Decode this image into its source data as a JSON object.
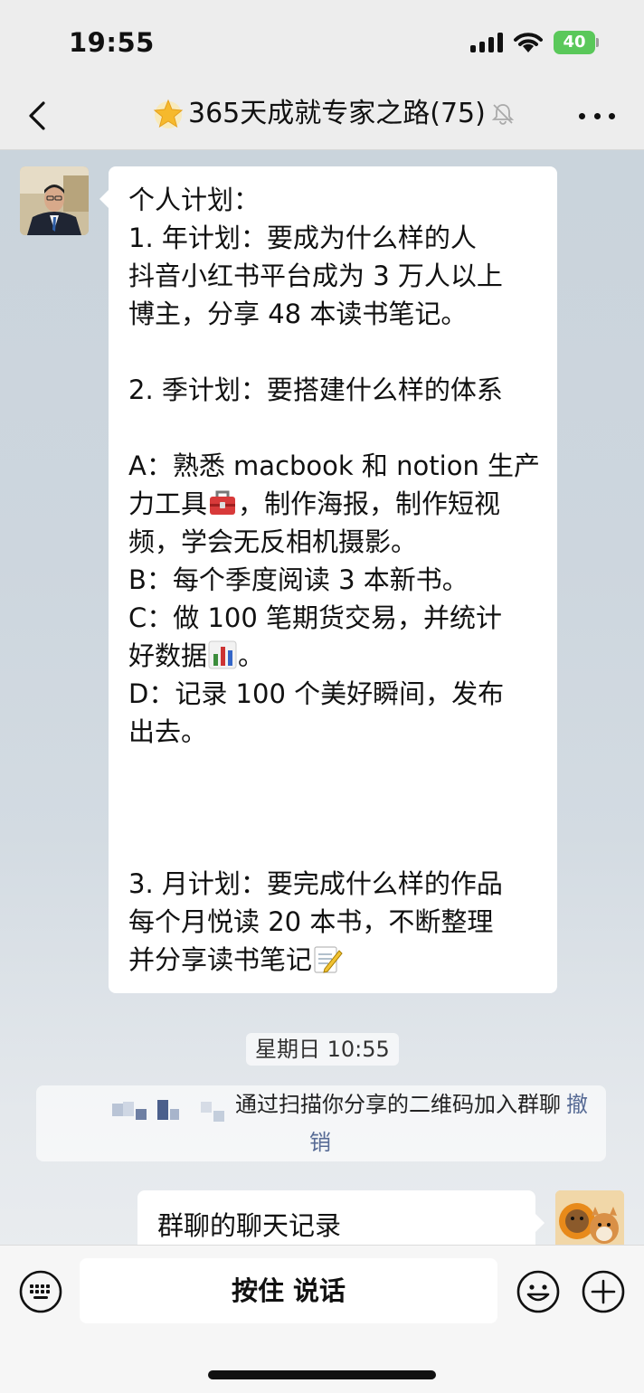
{
  "status_bar": {
    "time": "19:55",
    "battery": "40"
  },
  "nav": {
    "title": "365天成就专家之路(75)"
  },
  "message_main": {
    "lines": [
      "个人计划：",
      "1. 年计划：要成为什么样的人",
      "抖音小红书平台成为 3 万人以上",
      "博主，分享 48 本读书笔记。",
      "",
      "2. 季计划：要搭建什么样的体系",
      "",
      "A：熟悉 macbook 和 notion 生产",
      "力工具",
      "，制作海报，制作短视",
      "频，学会无反相机摄影。",
      "B：每个季度阅读 3 本新书。",
      "C：做 100 笔期货交易，并统计",
      "好数据",
      "。",
      "D：记录 100 个美好瞬间，发布",
      "出去。",
      "3. 月计划：要完成什么样的作品",
      "每个月悦读 20 本书，不断整理",
      "并分享读书笔记"
    ],
    "emoji_toolbox": "toolbox-emoji",
    "emoji_chart": "bar-chart-emoji",
    "emoji_memo": "memo-emoji"
  },
  "timestamp": "星期日 10:55",
  "system_message": {
    "text": "通过扫描你分享的二维码加入群聊",
    "undo_a": "撤",
    "undo_b": "销"
  },
  "message_right": {
    "text": "群聊的聊天记录"
  },
  "input_bar": {
    "hold_to_talk": "按住 说话"
  },
  "colors": {
    "link": "#576b95",
    "battery": "#5ac85a"
  }
}
